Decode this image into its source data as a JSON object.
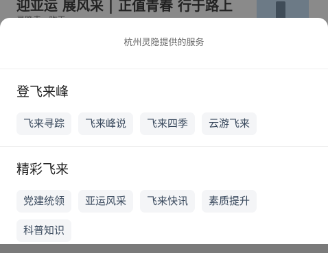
{
  "background": {
    "headline": "迎亚运 展风采 | 正值青春 行于路上",
    "subline": "灵隐寺 · 昨天"
  },
  "sheet": {
    "title": "杭州灵隐提供的服务",
    "sections": [
      {
        "heading": "登飞来峰",
        "items": [
          "飞来寻踪",
          "飞来峰说",
          "飞来四季",
          "云游飞来"
        ]
      },
      {
        "heading": "精彩飞来",
        "items": [
          "党建统领",
          "亚运风采",
          "飞来快讯",
          "素质提升",
          "科普知识"
        ]
      }
    ]
  }
}
